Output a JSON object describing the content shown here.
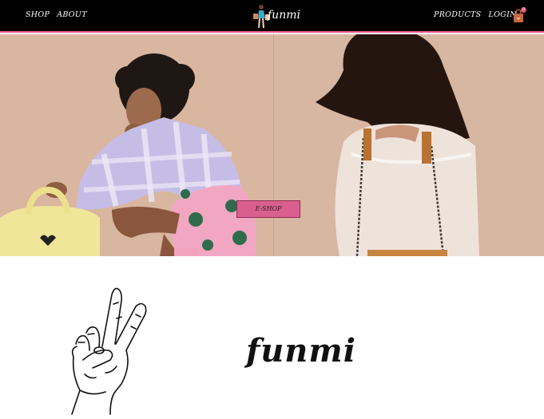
{
  "nav": {
    "left_links": [
      "SHOP",
      "ABOUT"
    ],
    "right_links": [
      "PRODUCTS",
      "LOGIN"
    ],
    "brand": "funmi",
    "cart_icon": "shopping-bag-icon",
    "cart_count": "0"
  },
  "hero": {
    "cta_label": "E-SHOP"
  },
  "about": {
    "wordmark": "funmi",
    "illustration": "peace-hand-icon"
  },
  "colors": {
    "accent": "#e0608f",
    "navbar": "#000000",
    "hero_bg": "#d8b8a1"
  }
}
